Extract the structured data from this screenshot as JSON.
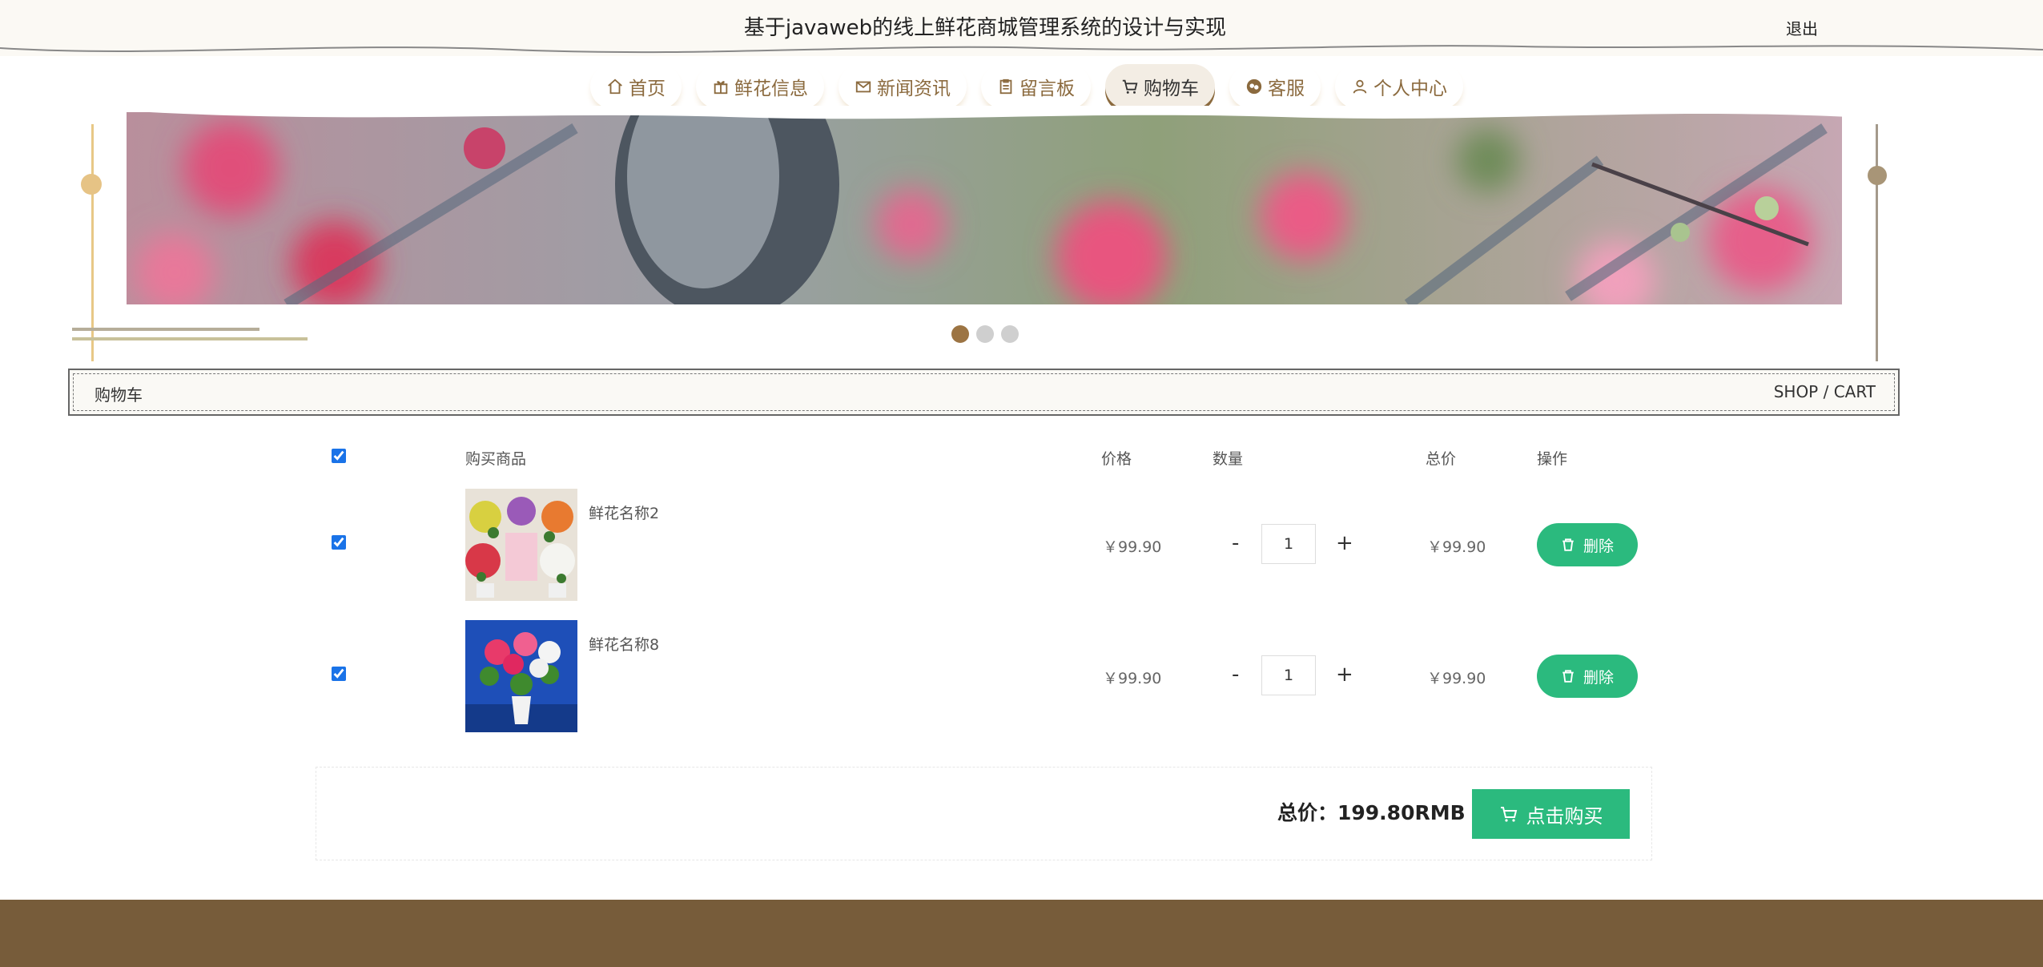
{
  "header": {
    "title": "基于javaweb的线上鲜花商城管理系统的设计与实现",
    "logout": "退出"
  },
  "nav": {
    "items": [
      {
        "label": "首页",
        "icon": "home-icon"
      },
      {
        "label": "鲜花信息",
        "icon": "gift-icon"
      },
      {
        "label": "新闻资讯",
        "icon": "mail-icon"
      },
      {
        "label": "留言板",
        "icon": "clipboard-icon"
      },
      {
        "label": "购物车",
        "icon": "cart-icon",
        "active": true
      },
      {
        "label": "客服",
        "icon": "chat-icon"
      },
      {
        "label": "个人中心",
        "icon": "user-icon"
      }
    ]
  },
  "carousel": {
    "count": 3,
    "active_index": 0
  },
  "breadcrumb": {
    "left": "购物车",
    "right": "SHOP / CART"
  },
  "table": {
    "headers": {
      "product": "购买商品",
      "price": "价格",
      "quantity": "数量",
      "total": "总价",
      "action": "操作"
    },
    "rows": [
      {
        "name": "鲜花名称2",
        "price": "￥99.90",
        "qty": "1",
        "total": "￥99.90",
        "delete": "删除",
        "checked": true
      },
      {
        "name": "鲜花名称8",
        "price": "￥99.90",
        "qty": "1",
        "total": "￥99.90",
        "delete": "删除",
        "checked": true
      }
    ],
    "minus": "-",
    "plus": "+"
  },
  "summary": {
    "total": "总价：199.80RMB",
    "buy": "点击购买"
  },
  "colors": {
    "brand_brown": "#775c3a",
    "accent_green": "#2bba7e",
    "nav_text": "#8b6a3e"
  }
}
